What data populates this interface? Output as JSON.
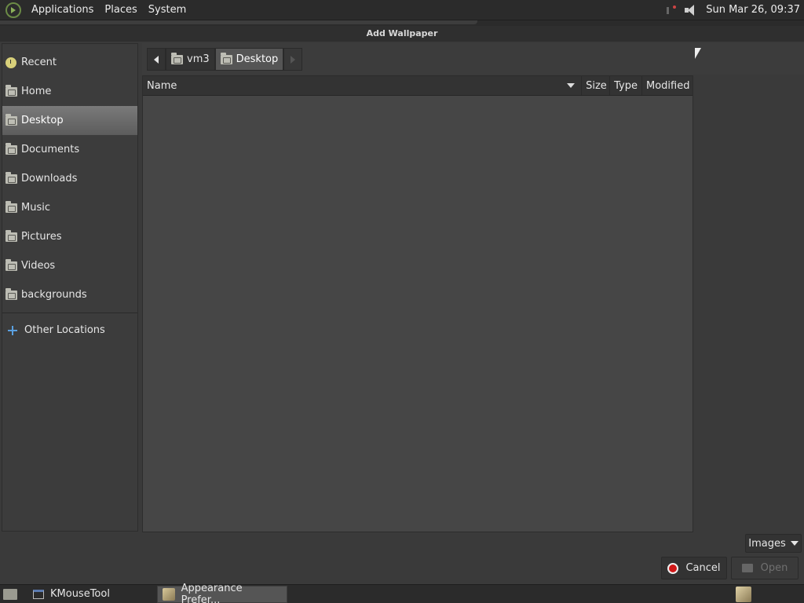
{
  "top_panel": {
    "menus": [
      "Applications",
      "Places",
      "System"
    ],
    "clock": "Sun Mar 26, 09:37",
    "icons": [
      "distro-logo-icon",
      "network-icon",
      "volume-icon"
    ]
  },
  "dialog": {
    "title": "Add Wallpaper",
    "sidebar": {
      "places": [
        {
          "label": "Recent",
          "icon": "recent-icon"
        },
        {
          "label": "Home",
          "icon": "home-folder-icon"
        },
        {
          "label": "Desktop",
          "icon": "desktop-folder-icon",
          "active": true
        },
        {
          "label": "Documents",
          "icon": "documents-folder-icon"
        },
        {
          "label": "Downloads",
          "icon": "downloads-folder-icon"
        },
        {
          "label": "Music",
          "icon": "music-folder-icon"
        },
        {
          "label": "Pictures",
          "icon": "pictures-folder-icon"
        },
        {
          "label": "Videos",
          "icon": "videos-folder-icon"
        },
        {
          "label": "backgrounds",
          "icon": "folder-icon"
        }
      ],
      "other": {
        "label": "Other Locations",
        "icon": "plus-icon"
      }
    },
    "pathbar": {
      "segments": [
        {
          "label": "vm3",
          "icon": "home-folder-icon"
        },
        {
          "label": "Desktop",
          "icon": "desktop-folder-icon",
          "active": true
        }
      ]
    },
    "columns": {
      "name": "Name",
      "size": "Size",
      "type": "Type",
      "modified": "Modified"
    },
    "files": [],
    "filter": {
      "selected": "Images"
    },
    "buttons": {
      "cancel": "Cancel",
      "open": "Open"
    }
  },
  "taskbar": {
    "items": [
      {
        "label": "KMouseTool",
        "active": false
      },
      {
        "label": "Appearance Prefer...",
        "active": true
      }
    ]
  }
}
